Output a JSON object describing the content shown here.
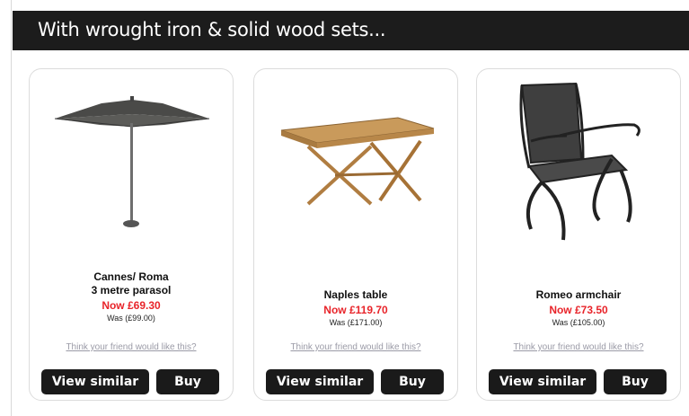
{
  "banner": {
    "title": "With wrought iron & solid wood sets..."
  },
  "products": [
    {
      "name_line1": "Cannes/ Roma",
      "name_line2": "3 metre parasol",
      "now_price": "Now £69.30",
      "was_price": "Was (£99.00)",
      "share_link": "Think your friend would like this?",
      "view_similar": "View similar",
      "buy": "Buy"
    },
    {
      "name_line1": "Naples table",
      "now_price": "Now £119.70",
      "was_price": "Was (£171.00)",
      "share_link": "Think your friend would like this?",
      "view_similar": "View similar",
      "buy": "Buy"
    },
    {
      "name_line1": "Romeo armchair",
      "now_price": "Now £73.50",
      "was_price": "Was (£105.00)",
      "share_link": "Think your friend would like this?",
      "view_similar": "View similar",
      "buy": "Buy"
    }
  ],
  "colors": {
    "banner": "#1c1c1c",
    "price_now": "#e8242a",
    "link": "#9a9aa6",
    "button": "#1a1a1a"
  }
}
